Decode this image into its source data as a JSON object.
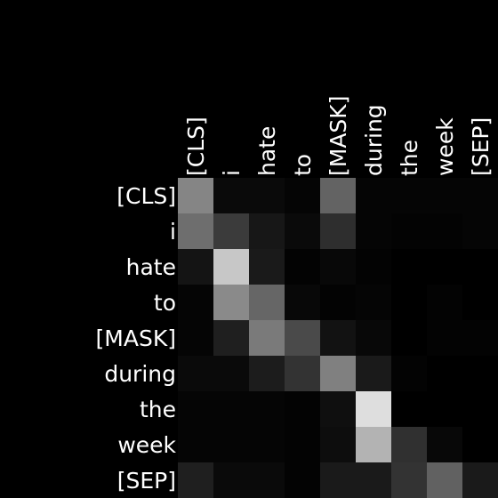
{
  "chart_data": {
    "type": "heatmap",
    "title": "",
    "xlabel": "",
    "ylabel": "",
    "x_tokens": [
      "[CLS]",
      "i",
      "hate",
      "to",
      "[MASK]",
      "during",
      "the",
      "week",
      "[SEP]"
    ],
    "y_tokens": [
      "[CLS]",
      "i",
      "hate",
      "to",
      "[MASK]",
      "during",
      "the",
      "week",
      "[SEP]"
    ],
    "value_range": [
      0,
      1
    ],
    "colormap": "grayscale",
    "colors": {
      "background": "#000000",
      "low": "#000000",
      "high": "#ffffff",
      "label": "#ffffff"
    },
    "values": [
      [
        0.52,
        0.04,
        0.04,
        0.02,
        0.39,
        0.02,
        0.02,
        0.02,
        0.02
      ],
      [
        0.43,
        0.23,
        0.09,
        0.04,
        0.18,
        0.02,
        0.01,
        0.01,
        0.02
      ],
      [
        0.08,
        0.78,
        0.1,
        0.01,
        0.03,
        0.01,
        0.0,
        0.0,
        0.0
      ],
      [
        0.02,
        0.54,
        0.4,
        0.03,
        0.01,
        0.02,
        0.0,
        0.01,
        0.0
      ],
      [
        0.02,
        0.12,
        0.48,
        0.29,
        0.07,
        0.03,
        0.0,
        0.01,
        0.01
      ],
      [
        0.04,
        0.04,
        0.11,
        0.2,
        0.5,
        0.1,
        0.01,
        0.0,
        0.0
      ],
      [
        0.02,
        0.02,
        0.02,
        0.01,
        0.06,
        0.87,
        0.0,
        0.0,
        0.0
      ],
      [
        0.02,
        0.02,
        0.02,
        0.01,
        0.05,
        0.7,
        0.19,
        0.03,
        0.0
      ],
      [
        0.12,
        0.04,
        0.04,
        0.01,
        0.1,
        0.1,
        0.2,
        0.38,
        0.1
      ]
    ]
  }
}
